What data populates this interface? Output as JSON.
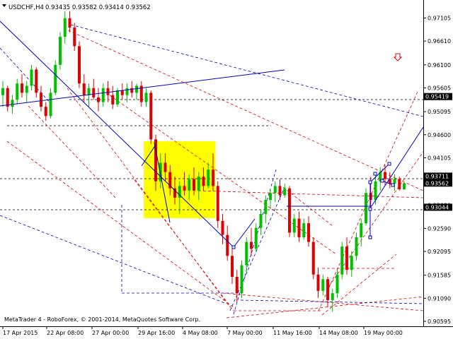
{
  "header": {
    "symbol": "USDCHF,H4",
    "ohlc": "0.93435 0.93582 0.93414 0.93562"
  },
  "footer": {
    "copyright": "MetaTrader 4 - RoboForex, © 2001-2014, MetaQuotes Software Corp."
  },
  "icons": {
    "signal": "down-arrow-icon"
  },
  "colors": {
    "bull": "#00c000",
    "bear": "#e00000",
    "trend": "#0000cc",
    "dash_red": "#e00000",
    "dash_blue": "#0000cc",
    "highlight": "#ffff00",
    "price_tag": "#000000"
  },
  "chart_data": {
    "type": "candlestick",
    "x_tick_labels": [
      "17 Apr 2015",
      "22 Apr 08:00",
      "27 Apr 00:00",
      "29 Apr 16:00",
      "4 May 08:00",
      "7 May 00:00",
      "11 May 16:00",
      "14 May 08:00",
      "19 May 00:00"
    ],
    "y_ticks": [
      0.97105,
      0.9661,
      0.961,
      0.95605,
      0.95095,
      0.946,
      0.94105,
      0.93595,
      0.9309,
      0.9259,
      0.92095,
      0.91585,
      0.9109,
      0.90595
    ],
    "y_tick_labels": [
      "0.97105",
      "0.96610",
      "0.96100",
      "0.95605",
      "0.95095",
      "0.94600",
      "0.94105",
      "0.93595",
      "0.93090",
      "0.92590",
      "0.92095",
      "0.91585",
      "0.91090",
      "0.90595"
    ],
    "ylim": [
      0.9055,
      0.9737
    ],
    "price_tags": [
      {
        "label": "0.95419",
        "value": 0.95419,
        "style": "inverse"
      },
      {
        "label": "0.93711",
        "value": 0.93711,
        "style": "inverse"
      },
      {
        "label": "0.93562",
        "value": 0.93562,
        "style": "inverse"
      },
      {
        "label": "0.93044",
        "value": 0.93044,
        "style": "inverse"
      }
    ],
    "highlight_zone": {
      "x_from": 29.5,
      "x_to": 44.5,
      "y_from": 0.9446,
      "y_to": 0.9281
    },
    "candles": [
      [
        0.9545,
        0.9575,
        0.952,
        0.956
      ],
      [
        0.956,
        0.9565,
        0.951,
        0.952
      ],
      [
        0.952,
        0.9545,
        0.9505,
        0.9535
      ],
      [
        0.9535,
        0.958,
        0.9525,
        0.957
      ],
      [
        0.957,
        0.959,
        0.954,
        0.955
      ],
      [
        0.955,
        0.9575,
        0.953,
        0.9565
      ],
      [
        0.9565,
        0.961,
        0.9555,
        0.96
      ],
      [
        0.96,
        0.9605,
        0.954,
        0.955
      ],
      [
        0.955,
        0.9565,
        0.951,
        0.952
      ],
      [
        0.952,
        0.953,
        0.949,
        0.95
      ],
      [
        0.95,
        0.956,
        0.9495,
        0.955
      ],
      [
        0.955,
        0.962,
        0.9545,
        0.961
      ],
      [
        0.961,
        0.968,
        0.96,
        0.967
      ],
      [
        0.967,
        0.9725,
        0.9655,
        0.971
      ],
      [
        0.971,
        0.9725,
        0.968,
        0.969
      ],
      [
        0.969,
        0.97,
        0.964,
        0.965
      ],
      [
        0.965,
        0.966,
        0.956,
        0.957
      ],
      [
        0.957,
        0.959,
        0.953,
        0.9545
      ],
      [
        0.9545,
        0.957,
        0.952,
        0.956
      ],
      [
        0.956,
        0.958,
        0.9535,
        0.954
      ],
      [
        0.954,
        0.956,
        0.951,
        0.953
      ],
      [
        0.953,
        0.957,
        0.952,
        0.956
      ],
      [
        0.956,
        0.9575,
        0.953,
        0.9545
      ],
      [
        0.9545,
        0.9565,
        0.9515,
        0.9525
      ],
      [
        0.9525,
        0.956,
        0.952,
        0.9555
      ],
      [
        0.9555,
        0.957,
        0.9535,
        0.9545
      ],
      [
        0.9545,
        0.957,
        0.953,
        0.956
      ],
      [
        0.956,
        0.9575,
        0.954,
        0.955
      ],
      [
        0.955,
        0.957,
        0.9535,
        0.9565
      ],
      [
        0.9565,
        0.9575,
        0.952,
        0.953
      ],
      [
        0.953,
        0.956,
        0.952,
        0.955
      ],
      [
        0.955,
        0.9555,
        0.944,
        0.945
      ],
      [
        0.945,
        0.946,
        0.934,
        0.936
      ],
      [
        0.936,
        0.942,
        0.9345,
        0.94
      ],
      [
        0.94,
        0.942,
        0.936,
        0.938
      ],
      [
        0.938,
        0.9395,
        0.933,
        0.9345
      ],
      [
        0.9345,
        0.937,
        0.931,
        0.9325
      ],
      [
        0.9325,
        0.936,
        0.929,
        0.935
      ],
      [
        0.935,
        0.938,
        0.933,
        0.934
      ],
      [
        0.934,
        0.9375,
        0.932,
        0.9365
      ],
      [
        0.9365,
        0.939,
        0.933,
        0.934
      ],
      [
        0.934,
        0.938,
        0.932,
        0.937
      ],
      [
        0.937,
        0.939,
        0.934,
        0.935
      ],
      [
        0.935,
        0.94,
        0.9345,
        0.9385
      ],
      [
        0.9385,
        0.942,
        0.934,
        0.935
      ],
      [
        0.935,
        0.936,
        0.926,
        0.9275
      ],
      [
        0.9275,
        0.929,
        0.9225,
        0.9245
      ],
      [
        0.9245,
        0.9265,
        0.919,
        0.92
      ],
      [
        0.92,
        0.9215,
        0.914,
        0.9155
      ],
      [
        0.9155,
        0.917,
        0.91,
        0.912
      ],
      [
        0.912,
        0.919,
        0.911,
        0.918
      ],
      [
        0.918,
        0.924,
        0.916,
        0.923
      ],
      [
        0.923,
        0.926,
        0.92,
        0.9215
      ],
      [
        0.9215,
        0.927,
        0.921,
        0.926
      ],
      [
        0.926,
        0.93,
        0.9245,
        0.929
      ],
      [
        0.929,
        0.933,
        0.927,
        0.932
      ],
      [
        0.932,
        0.9345,
        0.93,
        0.9335
      ],
      [
        0.9335,
        0.936,
        0.9315,
        0.935
      ],
      [
        0.935,
        0.9365,
        0.932,
        0.933
      ],
      [
        0.933,
        0.9355,
        0.9325,
        0.9345
      ],
      [
        0.9345,
        0.935,
        0.924,
        0.925
      ],
      [
        0.925,
        0.929,
        0.924,
        0.928
      ],
      [
        0.928,
        0.9295,
        0.923,
        0.924
      ],
      [
        0.924,
        0.928,
        0.9235,
        0.927
      ],
      [
        0.927,
        0.9285,
        0.922,
        0.923
      ],
      [
        0.923,
        0.924,
        0.915,
        0.916
      ],
      [
        0.916,
        0.9175,
        0.911,
        0.9125
      ],
      [
        0.9125,
        0.916,
        0.9115,
        0.915
      ],
      [
        0.915,
        0.9155,
        0.909,
        0.9105
      ],
      [
        0.9105,
        0.913,
        0.908,
        0.912
      ],
      [
        0.912,
        0.917,
        0.911,
        0.916
      ],
      [
        0.916,
        0.923,
        0.915,
        0.922
      ],
      [
        0.922,
        0.924,
        0.916,
        0.917
      ],
      [
        0.917,
        0.921,
        0.9155,
        0.92
      ],
      [
        0.92,
        0.925,
        0.919,
        0.924
      ],
      [
        0.924,
        0.928,
        0.922,
        0.927
      ],
      [
        0.927,
        0.9345,
        0.9265,
        0.9335
      ],
      [
        0.9335,
        0.937,
        0.93,
        0.932
      ],
      [
        0.932,
        0.9375,
        0.931,
        0.936
      ],
      [
        0.936,
        0.939,
        0.934,
        0.938
      ],
      [
        0.938,
        0.9395,
        0.935,
        0.9365
      ],
      [
        0.9365,
        0.938,
        0.9345,
        0.9355
      ],
      [
        0.9355,
        0.9375,
        0.934,
        0.9365
      ],
      [
        0.9365,
        0.937,
        0.934,
        0.9343
      ],
      [
        0.9343,
        0.9358,
        0.9341,
        0.9356
      ]
    ]
  }
}
